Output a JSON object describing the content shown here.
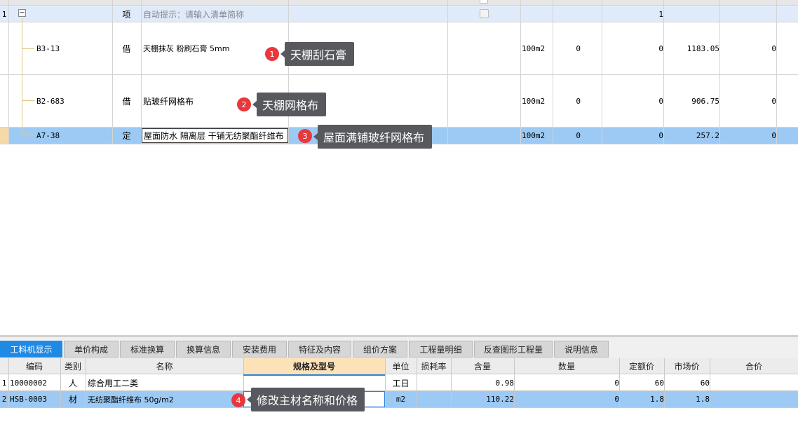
{
  "top_header": {
    "checkbox_label": ""
  },
  "rows": [
    {
      "index": "1",
      "code": "",
      "type": "项",
      "name": "自动提示：请输入清单简称",
      "unit": "",
      "c1": "",
      "c2": "1",
      "c3": "",
      "c4": ""
    },
    {
      "index": "",
      "code": "B3-13",
      "type": "借",
      "name": "天棚抹灰 粉刷石膏 5mm",
      "unit": "100m2",
      "c1": "0",
      "c2": "0",
      "c3": "1183.05",
      "c4": "0"
    },
    {
      "index": "",
      "code": "B2-683",
      "type": "借",
      "name": "贴玻纤网格布",
      "unit": "100m2",
      "c1": "0",
      "c2": "0",
      "c3": "906.75",
      "c4": "0"
    },
    {
      "index": "",
      "code": "A7-38",
      "type": "定",
      "name": "屋面防水 隔离层 干铺无纺聚酯纤维布",
      "unit": "100m2",
      "c1": "0",
      "c2": "0",
      "c3": "257.2",
      "c4": "0"
    }
  ],
  "callouts": [
    {
      "num": "1",
      "text": "天棚刮石膏"
    },
    {
      "num": "2",
      "text": "天棚网格布"
    },
    {
      "num": "3",
      "text": "屋面满铺玻纤网格布"
    },
    {
      "num": "4",
      "text": "修改主材名称和价格"
    }
  ],
  "tabs": [
    "工料机显示",
    "单价构成",
    "标准换算",
    "换算信息",
    "安装费用",
    "特征及内容",
    "组价方案",
    "工程量明细",
    "反查图形工程量",
    "说明信息"
  ],
  "bottom_headers": [
    "编码",
    "类别",
    "名称",
    "规格及型号",
    "单位",
    "损耗率",
    "含量",
    "数量",
    "定额价",
    "市场价",
    "合价"
  ],
  "bottom_rows": [
    {
      "index": "1",
      "code": "10000002",
      "type": "人",
      "name": "综合用工二类",
      "spec": "",
      "unit": "工日",
      "loss": "",
      "content": "0.98",
      "qty": "0",
      "price": "60",
      "market": "60",
      "total": ""
    },
    {
      "index": "2",
      "code": "HSB-0003",
      "type": "材",
      "name": "无纺聚酯纤维布 50g/m2",
      "spec": "",
      "unit": "m2",
      "loss": "",
      "content": "110.22",
      "qty": "0",
      "price": "1.8",
      "market": "1.8",
      "total": ""
    }
  ]
}
